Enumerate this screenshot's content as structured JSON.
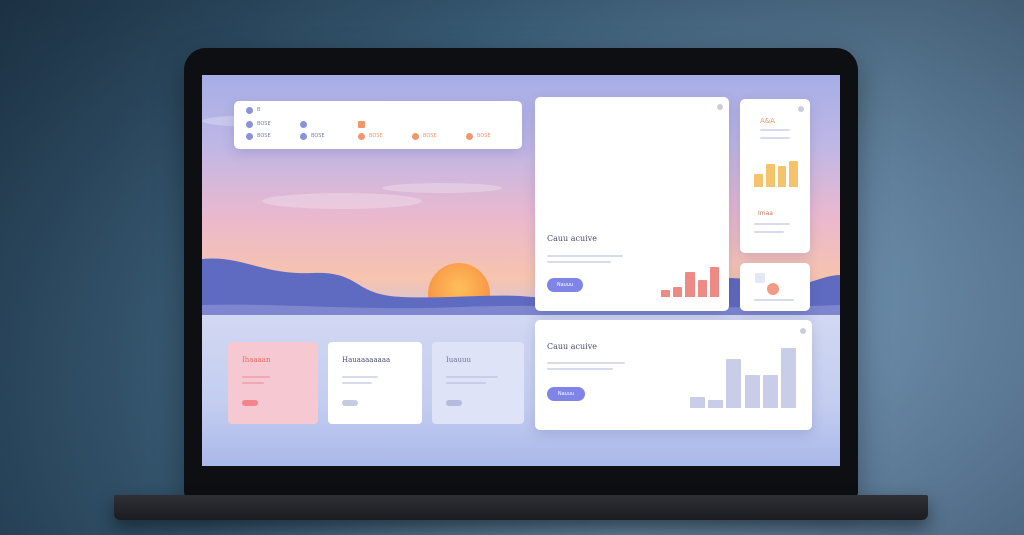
{
  "nav": {
    "brand": "B",
    "row1_label": "BOSE",
    "items": [
      {
        "label": "BOSE"
      },
      {
        "label": "BOSE"
      },
      {
        "label": "BOSE"
      },
      {
        "label": "BOSE"
      },
      {
        "label": "BOSE"
      },
      {
        "label": "BOSE"
      }
    ]
  },
  "card_main": {
    "title": "Cauu acuive",
    "button": "Nauuu"
  },
  "card_tall": {
    "title": "A&A",
    "subtitle": "Imaa"
  },
  "card_wide": {
    "title": "Cauu acuive",
    "button": "Nauuu"
  },
  "mini_cards": [
    {
      "title": "Ihaaaan"
    },
    {
      "title": "Hauaaaaaaaa"
    },
    {
      "title": "Iuauuu"
    }
  ],
  "colors": {
    "accent": "#7f85e6",
    "bar_coral": "#ee8a86",
    "bar_yellow": "#f4c36b",
    "bar_lavender": "#c9cde8"
  },
  "chart_main": {
    "values": [
      3,
      4,
      10,
      7,
      12
    ]
  },
  "chart_tall": {
    "values": [
      5,
      9,
      8,
      10
    ]
  },
  "chart_wide": {
    "values": [
      4,
      3,
      18,
      12,
      12,
      22
    ]
  }
}
